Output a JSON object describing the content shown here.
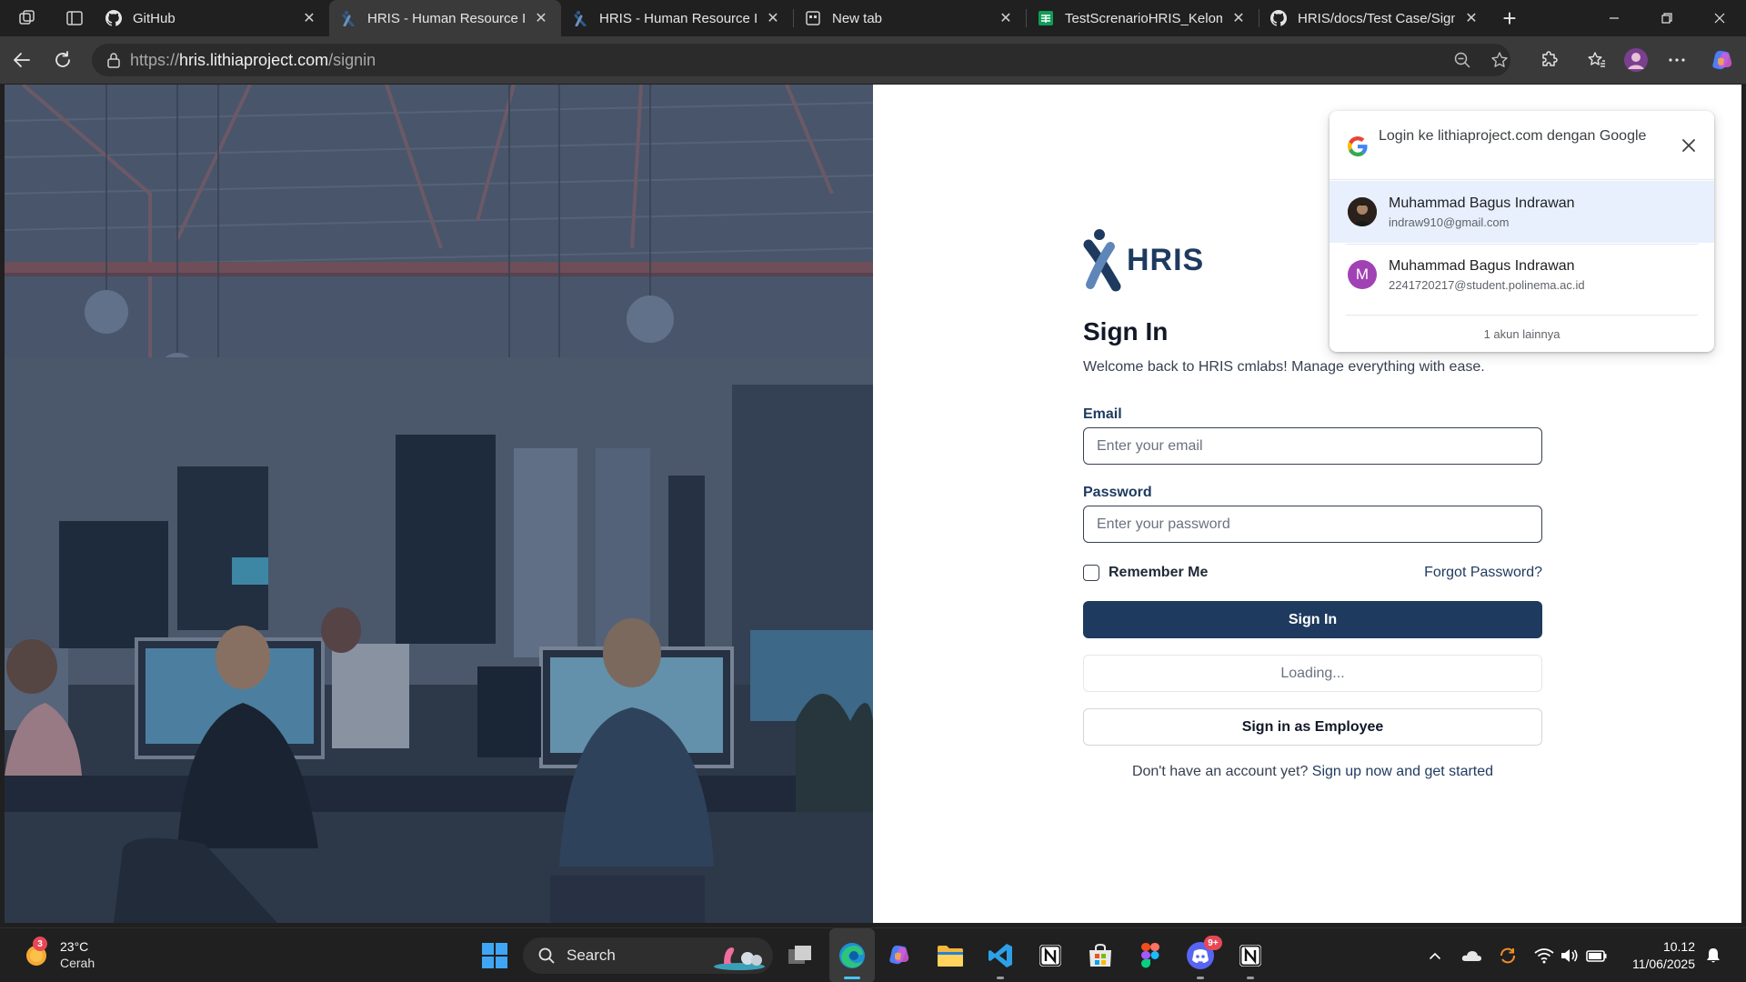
{
  "browser": {
    "tabs": [
      {
        "title": "GitHub",
        "active": false
      },
      {
        "title": "HRIS - Human Resource Information System",
        "active": true
      },
      {
        "title": "HRIS - Human Resource Information System",
        "active": false
      },
      {
        "title": "New tab",
        "active": false
      },
      {
        "title": "TestScrenarioHRIS_Kelompok",
        "active": false
      },
      {
        "title": "HRIS/docs/Test Case/Sign In",
        "active": false
      }
    ],
    "url_scheme": "https://",
    "url_host": "hris.lithiaproject.com",
    "url_path": "/signin"
  },
  "page": {
    "logo_text": "HRIS",
    "title": "Sign In",
    "subtitle": "Welcome back to HRIS cmlabs! Manage everything with ease.",
    "email_label": "Email",
    "email_placeholder": "Enter your email",
    "password_label": "Password",
    "password_placeholder": "Enter your password",
    "remember_label": "Remember Me",
    "forgot_label": "Forgot Password?",
    "signin_button": "Sign In",
    "loading_button": "Loading...",
    "employee_button": "Sign in as Employee",
    "signup_prompt": "Don't have an account yet?",
    "signup_link": "Sign up now and get started"
  },
  "google_popup": {
    "title": "Login ke lithiaproject.com dengan Google",
    "accounts": [
      {
        "name": "Muhammad Bagus Indrawan",
        "email": "indraw910@gmail.com",
        "selected": true
      },
      {
        "name": "Muhammad Bagus Indrawan",
        "email": "2241720217@student.polinema.ac.id",
        "initial": "M",
        "selected": false
      }
    ],
    "more_accounts": "1 akun lainnya"
  },
  "taskbar": {
    "weather_badge": "3",
    "temperature": "23°C",
    "condition": "Cerah",
    "search_label": "Search",
    "discord_badge": "9+",
    "time": "10.12",
    "date": "11/06/2025"
  },
  "colors": {
    "primary": "#1e3a5f",
    "browser_chrome": "#202020",
    "toolbar": "#3a3a3a",
    "google_selected": "#e8f0fe"
  }
}
